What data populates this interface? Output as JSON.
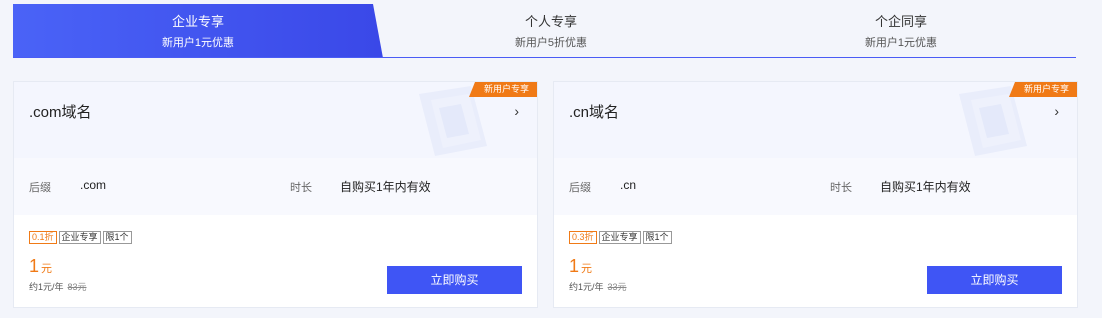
{
  "tabs": [
    {
      "title": "企业专享",
      "subtitle": "新用户1元优惠"
    },
    {
      "title": "个人专享",
      "subtitle": "新用户5折优惠"
    },
    {
      "title": "个企同享",
      "subtitle": "新用户1元优惠"
    }
  ],
  "cards": [
    {
      "name": ".com域名",
      "ribbon": "新用户专享",
      "suffix_label": "后缀",
      "suffix_value": ".com",
      "duration_label": "时长",
      "duration_value": "自购买1年内有效",
      "tags": [
        "0.1折",
        "企业专享",
        "限1个"
      ],
      "price": "1",
      "price_unit": "元",
      "per_year": "约1元/年",
      "original_price": "83元",
      "buy_label": "立即购买"
    },
    {
      "name": ".cn域名",
      "ribbon": "新用户专享",
      "suffix_label": "后缀",
      "suffix_value": ".cn",
      "duration_label": "时长",
      "duration_value": "自购买1年内有效",
      "tags": [
        "0.3折",
        "企业专享",
        "限1个"
      ],
      "price": "1",
      "price_unit": "元",
      "per_year": "约1元/年",
      "original_price": "33元",
      "buy_label": "立即购买"
    }
  ],
  "colors": {
    "accent": "#3f55f5",
    "accent_gradient_start": "#4a63f7",
    "accent_gradient_end": "#3a48e8",
    "orange": "#f07a16",
    "page_bg": "#f3f5fb"
  },
  "icons": {
    "card_arrow": "chevron-right-icon",
    "card_decoration": "domain-card-decoration-icon"
  }
}
